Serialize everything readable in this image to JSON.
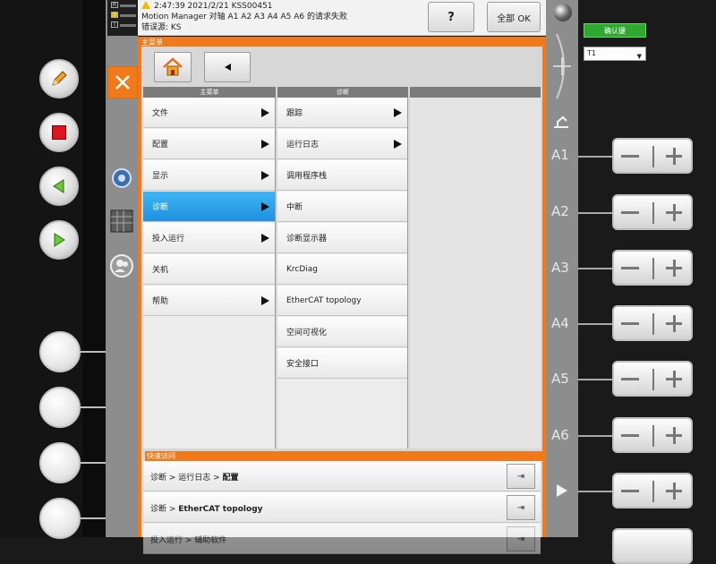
{
  "status": {
    "message_line1": "2:47:39 2021/2/21 KSS00451",
    "message_line2": "Motion Manager 对轴 A1 A2 A3 A4 A5 A6 的请求失败",
    "message_line3": "错误源: KS",
    "help_label": "?",
    "ok_all_label": "全部 OK"
  },
  "main_menu": {
    "title": "主菜单",
    "col1_header": "主菜单",
    "col2_header": "诊断",
    "col1_items": [
      {
        "label": "文件",
        "has_submenu": true
      },
      {
        "label": "配置",
        "has_submenu": true
      },
      {
        "label": "显示",
        "has_submenu": true
      },
      {
        "label": "诊断",
        "has_submenu": true,
        "selected": true
      },
      {
        "label": "投入运行",
        "has_submenu": true
      },
      {
        "label": "关机",
        "has_submenu": false
      },
      {
        "label": "帮助",
        "has_submenu": true
      }
    ],
    "col2_items": [
      {
        "label": "跟踪",
        "has_submenu": true
      },
      {
        "label": "运行日志",
        "has_submenu": true
      },
      {
        "label": "调用程序栈",
        "has_submenu": false
      },
      {
        "label": "中断",
        "has_submenu": false
      },
      {
        "label": "诊断显示器",
        "has_submenu": false
      },
      {
        "label": "KrcDiag",
        "has_submenu": false
      },
      {
        "label": "EtherCAT topology",
        "has_submenu": false
      },
      {
        "label": "空间可视化",
        "has_submenu": false
      },
      {
        "label": "安全接口",
        "has_submenu": false
      }
    ]
  },
  "quick_access": {
    "title": "快速访问",
    "items": [
      {
        "path": "诊断 > 运行日志 > ",
        "leaf": "配置"
      },
      {
        "path": "诊断 > ",
        "leaf": "EtherCAT topology"
      },
      {
        "path": "投入运行 > 辅助软件",
        "leaf": ""
      }
    ]
  },
  "right_panel": {
    "confirm_label": "确认键",
    "mode_value": "T1",
    "axes": [
      "A1",
      "A2",
      "A3",
      "A4",
      "A5",
      "A6"
    ]
  },
  "colors": {
    "accent": "#f07a1a",
    "selected": "#1e90e0",
    "confirm_green": "#2fa832"
  }
}
